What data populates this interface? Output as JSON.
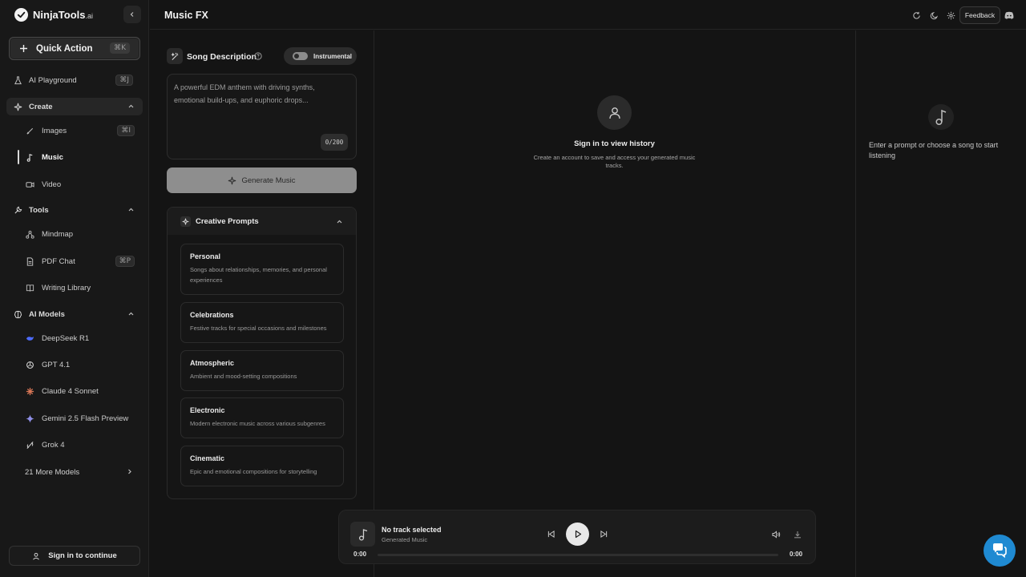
{
  "brand": {
    "name": "NinjaTools",
    "suffix": ".ai"
  },
  "quick_action": {
    "label": "Quick Action",
    "shortcut": "⌘K"
  },
  "sidebar": {
    "playground": {
      "label": "AI Playground",
      "shortcut": "⌘J"
    },
    "create": {
      "label": "Create",
      "items": [
        {
          "label": "Images",
          "shortcut": "⌘I"
        },
        {
          "label": "Music"
        },
        {
          "label": "Video"
        }
      ]
    },
    "tools": {
      "label": "Tools",
      "items": [
        {
          "label": "Mindmap"
        },
        {
          "label": "PDF Chat",
          "shortcut": "⌘P"
        },
        {
          "label": "Writing Library"
        }
      ]
    },
    "models": {
      "label": "AI Models",
      "items": [
        {
          "label": "DeepSeek R1",
          "icon": "deepseek-icon",
          "color": "#4d6bfe"
        },
        {
          "label": "GPT 4.1",
          "icon": "openai-icon",
          "color": "#cfcfcf"
        },
        {
          "label": "Claude 4 Sonnet",
          "icon": "claude-icon",
          "color": "#d97757"
        },
        {
          "label": "Gemini 2.5 Flash Preview",
          "icon": "gemini-icon",
          "color": "#8f8fe8"
        },
        {
          "label": "Grok 4",
          "icon": "grok-icon",
          "color": "#cfcfcf"
        }
      ],
      "more": "21 More Models"
    },
    "signin": "Sign in to continue"
  },
  "header": {
    "title": "Music FX",
    "feedback": "Feedback"
  },
  "composer": {
    "label": "Song Description",
    "toggle_label": "Instrumental",
    "placeholder": "A powerful EDM anthem with driving synths, emotional build-ups, and euphoric drops...",
    "char_count": "0/200",
    "generate_label": "Generate Music"
  },
  "creative_prompts": {
    "title": "Creative Prompts",
    "items": [
      {
        "title": "Personal",
        "desc": "Songs about relationships, memories, and personal experiences"
      },
      {
        "title": "Celebrations",
        "desc": "Festive tracks for special occasions and milestones"
      },
      {
        "title": "Atmospheric",
        "desc": "Ambient and mood-setting compositions"
      },
      {
        "title": "Electronic",
        "desc": "Modern electronic music across various subgenres"
      },
      {
        "title": "Cinematic",
        "desc": "Epic and emotional compositions for storytelling"
      }
    ]
  },
  "history": {
    "title": "Sign in to view history",
    "subtitle": "Create an account to save and access your generated music tracks."
  },
  "right_panel": {
    "note": "Enter a prompt or choose a song to start listening"
  },
  "player": {
    "title": "No track selected",
    "subtitle": "Generated Music",
    "time_current": "0:00",
    "time_total": "0:00",
    "progress": 0
  },
  "colors": {
    "accent_chat": "#1f8ad2",
    "button_disabled": "#8e8e8e"
  }
}
